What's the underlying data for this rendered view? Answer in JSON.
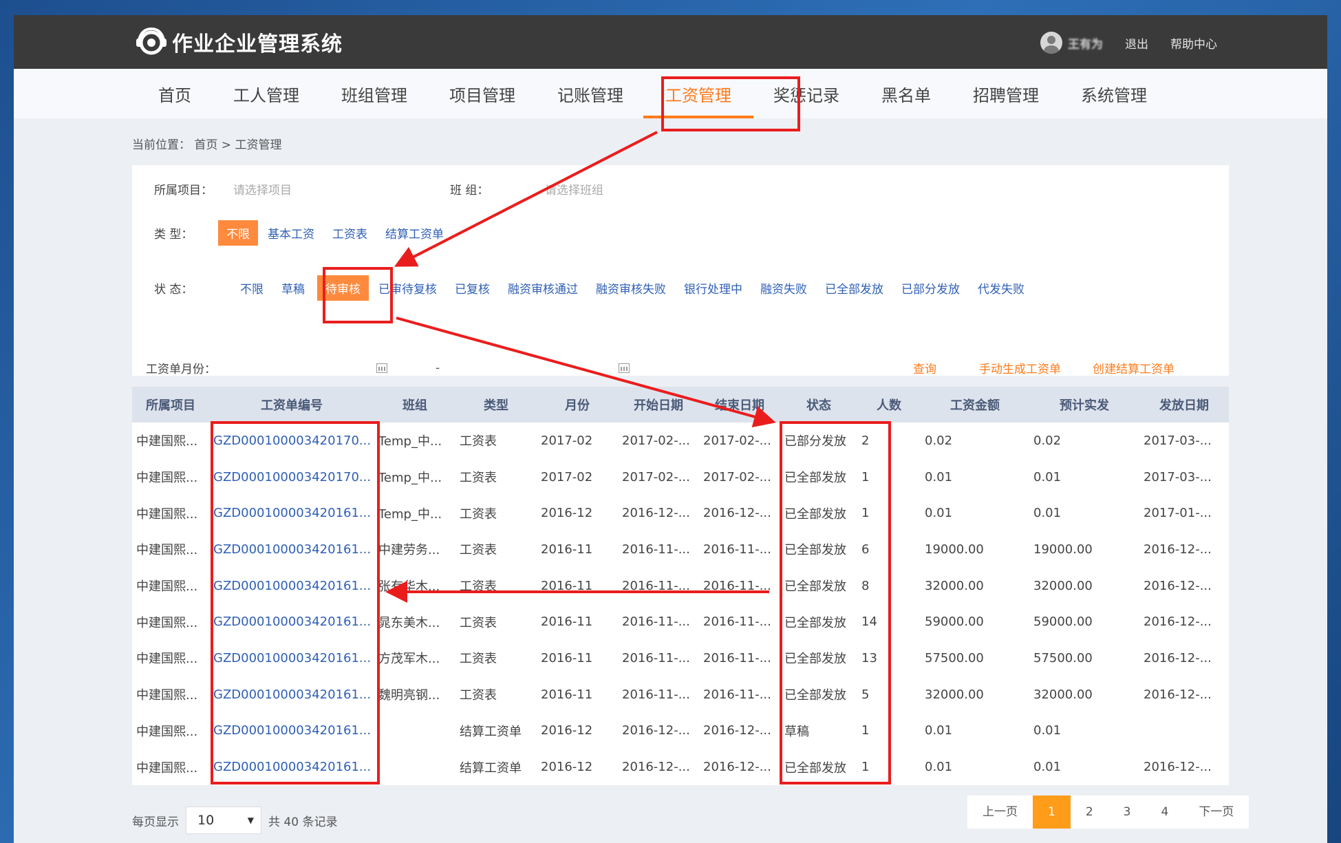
{
  "header": {
    "app_title": "作业企业管理系统",
    "username": "王有为",
    "logout": "退出",
    "help": "帮助中心"
  },
  "nav": [
    "首页",
    "工人管理",
    "班组管理",
    "项目管理",
    "记账管理",
    "工资管理",
    "奖惩记录",
    "黑名单",
    "招聘管理",
    "系统管理"
  ],
  "nav_active": "工资管理",
  "breadcrumb": "当前位置： 首页 > 工资管理",
  "filters": {
    "project_label": "所属项目：",
    "project_placeholder": "请选择项目",
    "team_label": "班 组：",
    "team_placeholder": "请选择班组",
    "type_label": "类 型：",
    "type_options": [
      "不限",
      "基本工资",
      "工资表",
      "结算工资单"
    ],
    "type_selected": "不限",
    "status_label": "状 态：",
    "status_options": [
      "不限",
      "草稿",
      "待审核",
      "已审待复核",
      "已复核",
      "融资审核通过",
      "融资审核失败",
      "银行处理中",
      "融资失败",
      "已全部发放",
      "已部分发放",
      "代发失败"
    ],
    "status_selected": "待审核",
    "month_label": "工资单月份：",
    "month_sep": "-",
    "actions": [
      "查询",
      "手动生成工资单",
      "创建结算工资单"
    ]
  },
  "table": {
    "columns": [
      "所属项目",
      "工资单编号",
      "班组",
      "类型",
      "月份",
      "开始日期",
      "结束日期",
      "状态",
      "人数",
      "工资金额",
      "预计实发",
      "发放日期"
    ],
    "rows": [
      [
        "中建国熙...",
        "GZD000100003420170...",
        "Temp_中...",
        "工资表",
        "2017-02",
        "2017-02-...",
        "2017-02-...",
        "已部分发放",
        "2",
        "0.02",
        "0.02",
        "2017-03-..."
      ],
      [
        "中建国熙...",
        "GZD000100003420170...",
        "Temp_中...",
        "工资表",
        "2017-02",
        "2017-02-...",
        "2017-02-...",
        "已全部发放",
        "1",
        "0.01",
        "0.01",
        "2017-03-..."
      ],
      [
        "中建国熙...",
        "GZD000100003420161...",
        "Temp_中...",
        "工资表",
        "2016-12",
        "2016-12-...",
        "2016-12-...",
        "已全部发放",
        "1",
        "0.01",
        "0.01",
        "2017-01-..."
      ],
      [
        "中建国熙...",
        "GZD000100003420161...",
        "中建劳务...",
        "工资表",
        "2016-11",
        "2016-11-...",
        "2016-11-...",
        "已全部发放",
        "6",
        "19000.00",
        "19000.00",
        "2016-12-..."
      ],
      [
        "中建国熙...",
        "GZD000100003420161...",
        "张有华木...",
        "工资表",
        "2016-11",
        "2016-11-...",
        "2016-11-...",
        "已全部发放",
        "8",
        "32000.00",
        "32000.00",
        "2016-12-..."
      ],
      [
        "中建国熙...",
        "GZD000100003420161...",
        "晁东美木...",
        "工资表",
        "2016-11",
        "2016-11-...",
        "2016-11-...",
        "已全部发放",
        "14",
        "59000.00",
        "59000.00",
        "2016-12-..."
      ],
      [
        "中建国熙...",
        "GZD000100003420161...",
        "方茂军木...",
        "工资表",
        "2016-11",
        "2016-11-...",
        "2016-11-...",
        "已全部发放",
        "13",
        "57500.00",
        "57500.00",
        "2016-12-..."
      ],
      [
        "中建国熙...",
        "GZD000100003420161...",
        "魏明亮钢...",
        "工资表",
        "2016-11",
        "2016-11-...",
        "2016-11-...",
        "已全部发放",
        "5",
        "32000.00",
        "32000.00",
        "2016-12-..."
      ],
      [
        "中建国熙...",
        "GZD000100003420161...",
        "",
        "结算工资单",
        "2016-12",
        "2016-12-...",
        "2016-12-...",
        "草稿",
        "1",
        "0.01",
        "0.01",
        ""
      ],
      [
        "中建国熙...",
        "GZD000100003420161...",
        "",
        "结算工资单",
        "2016-12",
        "2016-12-...",
        "2016-12-...",
        "已全部发放",
        "1",
        "0.01",
        "0.01",
        "2016-12-..."
      ]
    ]
  },
  "pagination": {
    "per_page_label": "每页显示",
    "per_page_value": "10",
    "total_text": "共 40 条记录",
    "prev": "上一页",
    "pages": [
      "1",
      "2",
      "3",
      "4"
    ],
    "current": "1",
    "next": "下一页"
  },
  "colors": {
    "accent": "#ff7b1c",
    "link": "#2f5fb5",
    "header_bg": "#3b3a3a",
    "annotation_red": "#ea1d1d"
  }
}
